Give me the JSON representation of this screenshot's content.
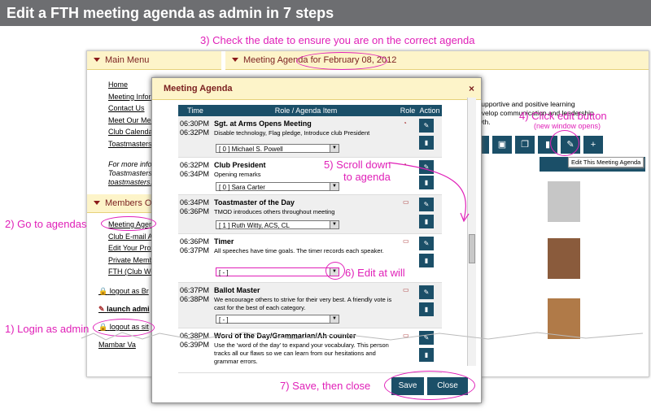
{
  "page_title": "Edit a FTH meeting agenda as admin in 7 steps",
  "steps": {
    "s1": "1) Login as admin",
    "s2": "2) Go to agendas",
    "s3": "3) Check the date to ensure you are on the correct agenda",
    "s4": "4) Click edit button",
    "s4b": "(new window opens)",
    "s5a": "5) Scroll down",
    "s5b": "to agenda",
    "s6": "6) Edit at will",
    "s7": "7) Save, then close"
  },
  "main_menu": {
    "title": "Main Menu",
    "items": [
      "Home",
      "Meeting Inform",
      "Contact Us",
      "Meet Our Mem",
      "Club Calendar",
      "Toastmasters"
    ],
    "more_text": [
      "For more inform",
      "Toastmasters In",
      "toastmasters.org"
    ]
  },
  "members_menu": {
    "title": "Members On",
    "items": [
      "Meeting Agend",
      "Club E-mail A",
      "Edit Your Profil",
      "Private Membe",
      "FTH (Club We"
    ],
    "links": [
      "logout as Br",
      "launch admi",
      "logout as sit",
      "Mambar Va"
    ]
  },
  "agenda_panel": {
    "title": "Meeting Agenda for February 08, 2012",
    "intro_lines": [
      "supportive and positive learning",
      "evelop communication and leadership",
      "wth."
    ],
    "side_header": "Me"
  },
  "tooltip": "Edit This Meeting Agenda",
  "modal": {
    "title": "Meeting Agenda",
    "close": "×",
    "columns": [
      "Time",
      "Role / Agenda Item",
      "Role",
      "Action"
    ],
    "rows": [
      {
        "t1": "06:30PM",
        "t2": "06:32PM",
        "name": "Sgt. at Arms Opens Meeting",
        "desc": "Disable technology, Flag pledge, Introduce club President",
        "sel": "[ 0 ] Michael S. Powell"
      },
      {
        "t1": "06:32PM",
        "t2": "06:34PM",
        "name": "Club President",
        "desc": "Opening remarks",
        "sel": "[ 0 ] Sara Carter"
      },
      {
        "t1": "06:34PM",
        "t2": "06:36PM",
        "name": "Toastmaster of the Day",
        "desc": "TMOD introduces others throughout meeting",
        "sel": "[ 1 ] Ruth Witty, ACS, CL"
      },
      {
        "t1": "06:36PM",
        "t2": "06:37PM",
        "name": "Timer",
        "desc": "All speeches have time goals. The timer records each speaker.",
        "sel": "[ - ]"
      },
      {
        "t1": "06:37PM",
        "t2": "06:38PM",
        "name": "Ballot Master",
        "desc": "We encourage others to strive for their very best. A friendly vote is cast for the best of each category.",
        "sel": "[ - ]"
      },
      {
        "t1": "06:38PM",
        "t2": "06:39PM",
        "name": "Word of the Day/Grammarian/Ah counter",
        "desc": "Use the 'word of the day' to expand your vocabulary. This person tracks all our flaws so we can learn from our hesitations and grammar errors.",
        "sel": ""
      }
    ],
    "save": "Save",
    "close_btn": "Close"
  },
  "colors": {
    "accent": "#1b4f68",
    "annotation": "#e020b8",
    "panel": "#fdf4c9"
  }
}
